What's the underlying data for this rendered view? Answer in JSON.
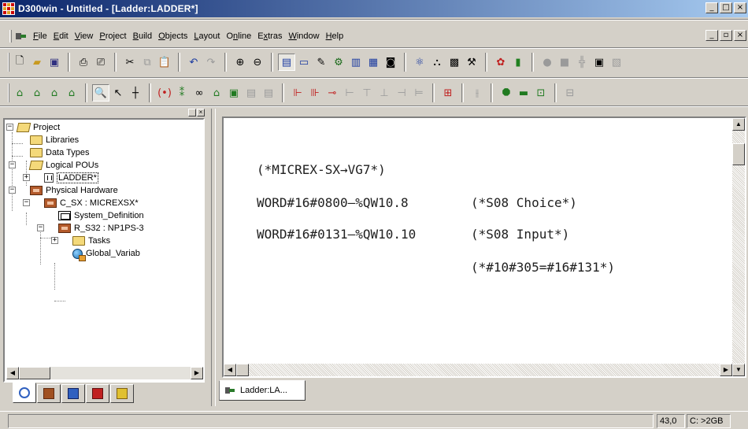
{
  "window": {
    "title": "D300win - Untitled - [Ladder:LADDER*]",
    "controls": [
      "_",
      "□",
      "×"
    ]
  },
  "menu": {
    "items": [
      {
        "label": "File",
        "underline": "F"
      },
      {
        "label": "Edit",
        "underline": "E"
      },
      {
        "label": "View",
        "underline": "V"
      },
      {
        "label": "Project",
        "underline": "P"
      },
      {
        "label": "Build",
        "underline": "B"
      },
      {
        "label": "Objects",
        "underline": "O"
      },
      {
        "label": "Layout",
        "underline": "L"
      },
      {
        "label": "Online",
        "underline": "n"
      },
      {
        "label": "Extras",
        "underline": "x"
      },
      {
        "label": "Window",
        "underline": "W"
      },
      {
        "label": "Help",
        "underline": "H"
      }
    ],
    "child_controls": [
      "_",
      "▫",
      "×"
    ]
  },
  "toolbar1": {
    "buttons": [
      "new-file-icon",
      "open-folder-icon",
      "save-icon",
      "print-preview-icon",
      "print-icon",
      "cut-icon",
      "copy-icon",
      "paste-icon",
      "undo-icon",
      "redo-icon",
      "zoom-in-icon",
      "zoom-out-icon",
      "project-tree-icon",
      "message-window-icon",
      "cross-reference-icon",
      "instance-tree-icon",
      "library-icon",
      "watch-icon",
      "compile-icon",
      "make-icon",
      "download-icon",
      "debug-icon",
      "settings-icon",
      "resource-icon",
      "power-flow-icon",
      "stop-icon",
      "network-icon",
      "monitor-icon"
    ]
  },
  "toolbar2": {
    "buttons": [
      "pou-icon",
      "variable-icon",
      "datatype-icon",
      "library-item-icon",
      "zoom-select-icon",
      "pointer-icon",
      "line-icon",
      "contact-icon",
      "coil-icon",
      "link-icon",
      "fb-icon",
      "block-icon",
      "gray-block-1-icon",
      "gray-block-2-icon",
      "parallel-contact-icon",
      "series-contact-icon",
      "negated-contact-icon",
      "gray-contact-1-icon",
      "gray-contact-2-icon",
      "gray-contact-3-icon",
      "gray-contact-4-icon",
      "gray-contact-5-icon",
      "network-comment-icon",
      "gray-jump-icon",
      "jump-icon",
      "return-icon",
      "label-icon",
      "gray-label-icon"
    ]
  },
  "tree": {
    "nodes": [
      {
        "label": "Project",
        "level": 0,
        "expander": "−",
        "icon": "folder-open"
      },
      {
        "label": "Libraries",
        "level": 1,
        "expander": "",
        "icon": "folder"
      },
      {
        "label": "Data Types",
        "level": 1,
        "expander": "",
        "icon": "folder"
      },
      {
        "label": "Logical POUs",
        "level": 1,
        "expander": "−",
        "icon": "folder-open"
      },
      {
        "label": "LADDER*",
        "level": 2,
        "expander": "+",
        "icon": "pou",
        "selected": true
      },
      {
        "label": "Physical Hardware",
        "level": 1,
        "expander": "−",
        "icon": "hw"
      },
      {
        "label": "C_SX : MICREXSX*",
        "level": 2,
        "expander": "−",
        "icon": "hw"
      },
      {
        "label": "System_Definition",
        "level": 3,
        "expander": "",
        "icon": "sysdef"
      },
      {
        "label": "R_S32 : NP1PS-3",
        "level": 3,
        "expander": "−",
        "icon": "hw"
      },
      {
        "label": "Tasks",
        "level": 4,
        "expander": "+",
        "icon": "folder"
      },
      {
        "label": "Global_Variab",
        "level": 4,
        "expander": "",
        "icon": "globe"
      }
    ],
    "bottom_tabs": [
      "project-tree-tab-icon",
      "hardware-tab-icon",
      "library-tab-icon",
      "instance-tab-icon",
      "io-tab-icon"
    ]
  },
  "editor": {
    "lines": [
      "(*MICREX-SX→VG7*)",
      "WORD#16#0800—%QW10.8",
      "WORD#16#0131—%QW10.10"
    ],
    "comments": [
      "(*S08 Choice*)",
      "(*S08 Input*)",
      "(*#10#305=#16#131*)"
    ],
    "tab_label": "Ladder:LA..."
  },
  "status": {
    "zoom": "43,0",
    "disk": "C: >2GB"
  },
  "colors": {
    "titlebar_start": "#0a246a",
    "titlebar_end": "#a6caf0",
    "face": "#d4d0c8"
  }
}
